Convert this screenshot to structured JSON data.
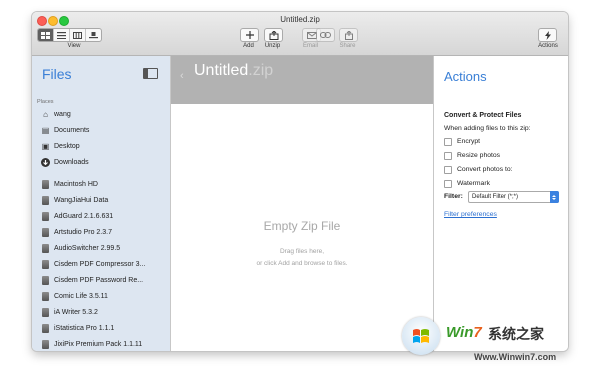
{
  "window": {
    "title": "Untitled.zip"
  },
  "toolbar": {
    "view_label": "View",
    "add_label": "Add",
    "unzip_label": "Unzip",
    "email_label": "Email",
    "share_label": "Share",
    "actions_label": "Actions"
  },
  "sidebar": {
    "title": "Files",
    "section": "Places",
    "places": [
      {
        "label": "wang",
        "icon": "home-icon"
      },
      {
        "label": "Documents",
        "icon": "documents-icon"
      },
      {
        "label": "Desktop",
        "icon": "desktop-icon"
      },
      {
        "label": "Downloads",
        "icon": "downloads-icon"
      }
    ],
    "volumes": [
      {
        "label": "Macintosh HD"
      },
      {
        "label": "WangJiaHui Data"
      },
      {
        "label": "AdGuard 2.1.6.631"
      },
      {
        "label": "Artstudio Pro 2.3.7"
      },
      {
        "label": "AudioSwitcher 2.99.5"
      },
      {
        "label": "Cisdem PDF Compressor 3..."
      },
      {
        "label": "Cisdem PDF Password Re..."
      },
      {
        "label": "Comic Life 3.5.11"
      },
      {
        "label": "iA Writer 5.3.2"
      },
      {
        "label": "iStatistica Pro 1.1.1"
      },
      {
        "label": "JixiPix Premium Pack 1.1.11"
      }
    ]
  },
  "main": {
    "zip_name": "Untitled",
    "zip_ext": ".zip",
    "empty_title": "Empty Zip File",
    "help_line1": "Drag files here,",
    "help_line2": "or click Add and browse to files."
  },
  "actions": {
    "title": "Actions",
    "subtitle": "Convert & Protect Files",
    "note": "When adding files to this zip:",
    "options": [
      {
        "label": "Encrypt",
        "checked": false
      },
      {
        "label": "Resize photos",
        "checked": false
      },
      {
        "label": "Convert photos to:",
        "checked": false
      },
      {
        "label": "Watermark",
        "checked": false
      }
    ],
    "filter_label": "Filter:",
    "filter_value": "Default Filter (*;*)",
    "filter_prefs": "Filter preferences"
  },
  "watermark": {
    "brand_win": "Win",
    "brand_7": "7",
    "brand_cn": "系统之家",
    "url": "Www.Winwin7.com"
  },
  "colors": {
    "accent": "#3a7fd6",
    "sidebar_bg": "#dde6f1",
    "header_bg": "#b2b2b2"
  }
}
